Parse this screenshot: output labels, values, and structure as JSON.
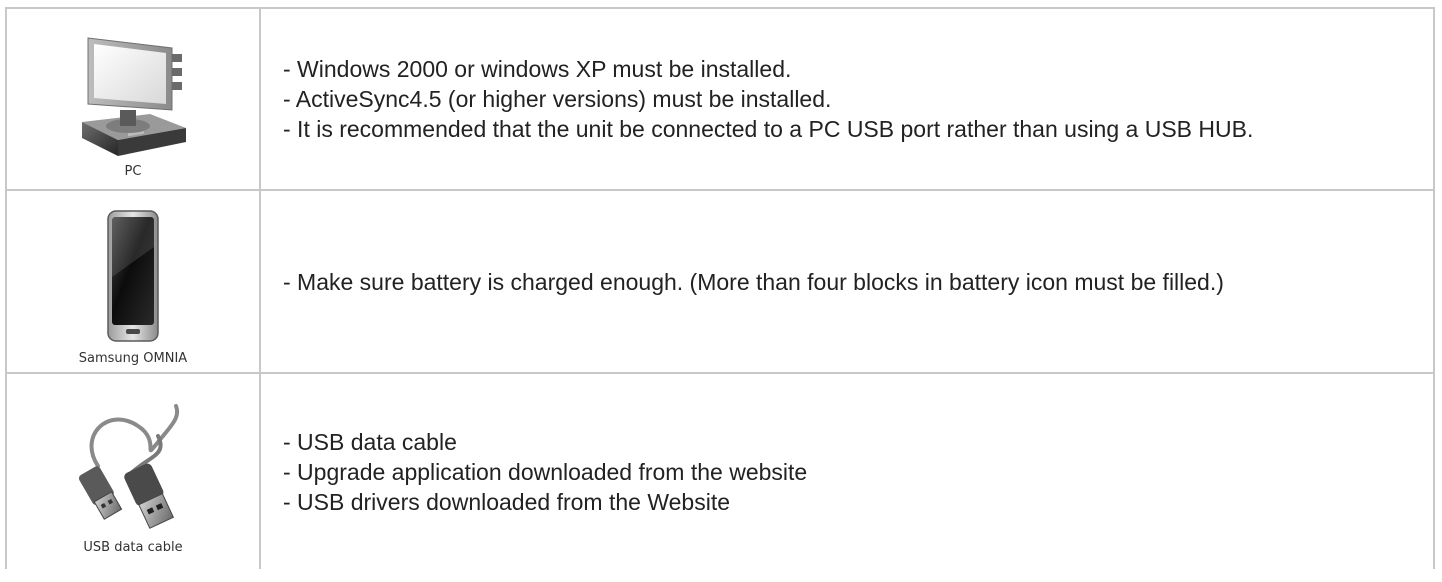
{
  "rows": [
    {
      "device": "PC",
      "icon": "desktop-pc-icon",
      "lines": [
        "- Windows 2000 or windows XP must be installed.",
        "- ActiveSync4.5 (or higher versions) must be installed.",
        "- It is recommended that the unit be connected to a PC USB port rather than using a USB HUB."
      ]
    },
    {
      "device": "Samsung OMNIA",
      "icon": "smartphone-icon",
      "lines": [
        "- Make sure battery is charged enough. (More than four blocks in battery icon must be filled.)"
      ]
    },
    {
      "device": "USB data cable",
      "icon": "usb-cable-icon",
      "lines": [
        "- USB data cable",
        "- Upgrade application downloaded from the website",
        "- USB drivers downloaded from the Website"
      ]
    }
  ]
}
